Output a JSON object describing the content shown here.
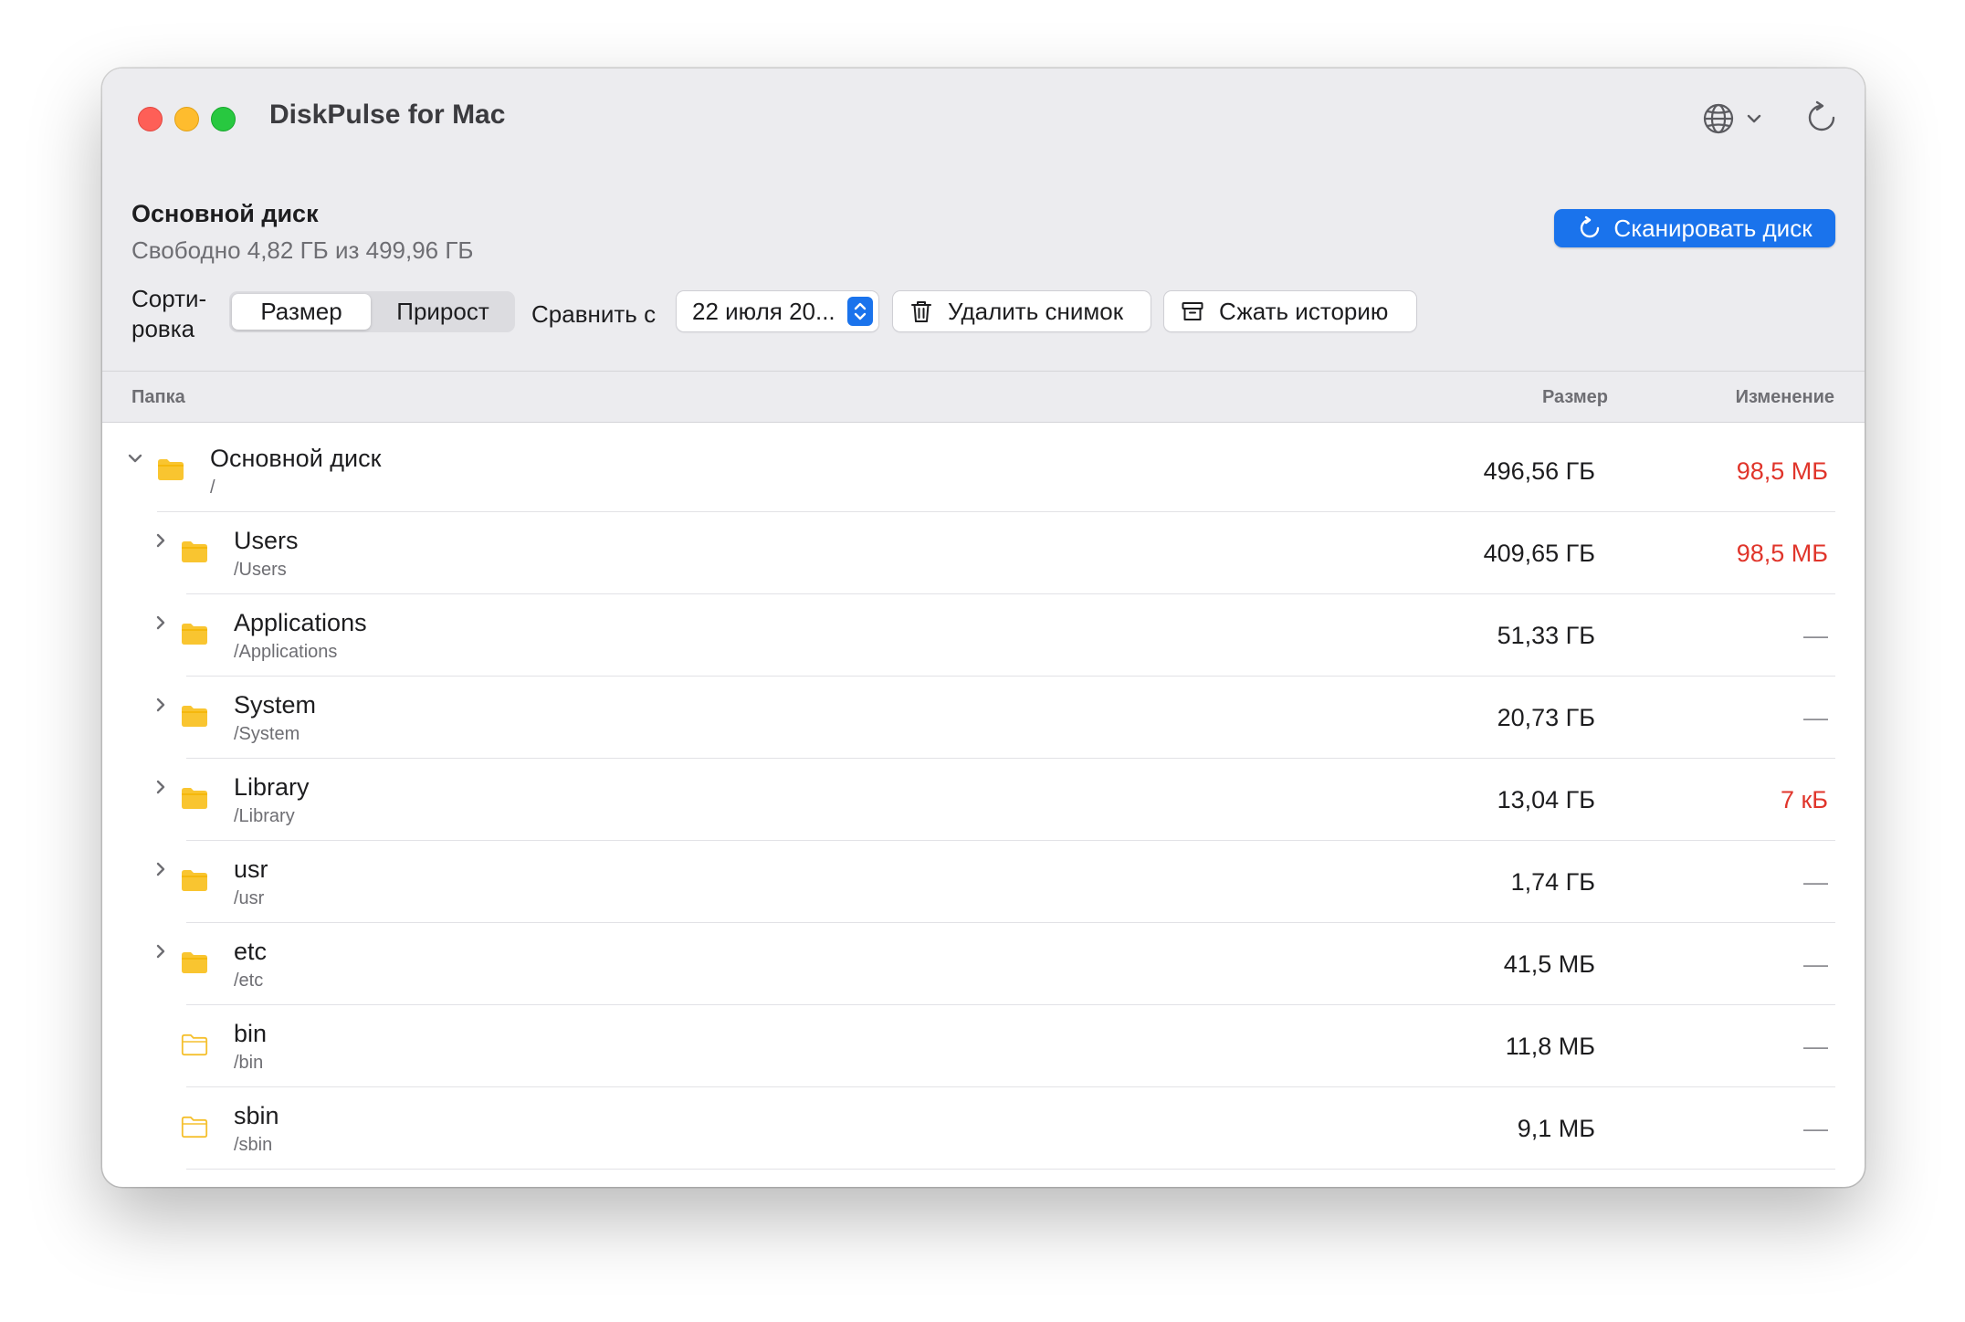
{
  "window": {
    "title": "DiskPulse for Mac"
  },
  "disk": {
    "title": "Основной диск",
    "subtitle": "Свободно 4,82 ГБ из 499,96 ГБ"
  },
  "toolbar": {
    "scan_label": "Сканировать диск",
    "sort_label_line1": "Сорти-",
    "sort_label_line2": "ровка",
    "sort_options": [
      "Размер",
      "Прирост"
    ],
    "sort_selected": "Размер",
    "compare_label": "Сравнить с",
    "compare_date": "22 июля 20...",
    "delete_label": "Удалить снимок",
    "compress_label": "Сжать историю"
  },
  "columns": {
    "folder": "Папка",
    "size": "Размер",
    "change": "Изменение"
  },
  "rows": [
    {
      "name": "Основной диск",
      "path": "/",
      "size": "496,56 ГБ",
      "change": "98,5 МБ"
    },
    {
      "name": "Users",
      "path": "/Users",
      "size": "409,65 ГБ",
      "change": "98,5 МБ"
    },
    {
      "name": "Applications",
      "path": "/Applications",
      "size": "51,33 ГБ",
      "change": "—"
    },
    {
      "name": "System",
      "path": "/System",
      "size": "20,73 ГБ",
      "change": "—"
    },
    {
      "name": "Library",
      "path": "/Library",
      "size": "13,04 ГБ",
      "change": "7 кБ"
    },
    {
      "name": "usr",
      "path": "/usr",
      "size": "1,74 ГБ",
      "change": "—"
    },
    {
      "name": "etc",
      "path": "/etc",
      "size": "41,5 МБ",
      "change": "—"
    },
    {
      "name": "bin",
      "path": "/bin",
      "size": "11,8 МБ",
      "change": "—"
    },
    {
      "name": "sbin",
      "path": "/sbin",
      "size": "9,1 МБ",
      "change": "—"
    }
  ],
  "colors": {
    "accent": "#1a73ec",
    "increase": "#e0352b",
    "folder": "#f9c530"
  }
}
